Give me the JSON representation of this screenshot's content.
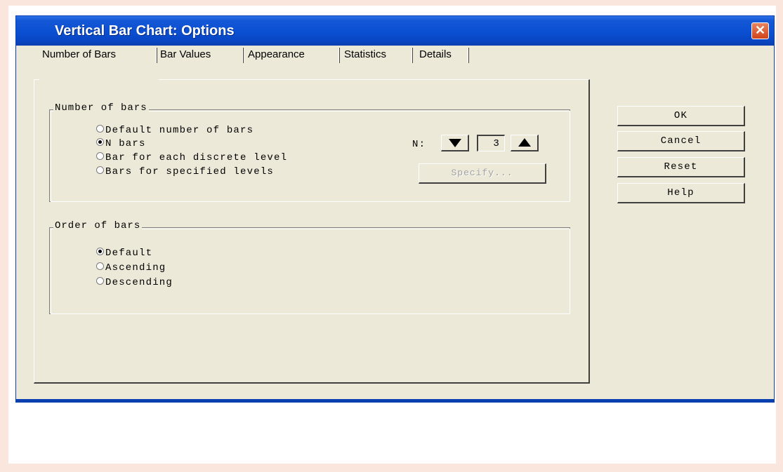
{
  "dialog": {
    "title": "Vertical Bar Chart: Options",
    "close_glyph": "✕"
  },
  "tabs": [
    {
      "label": "Number of Bars",
      "active": true
    },
    {
      "label": "Bar Values",
      "active": false
    },
    {
      "label": "Appearance",
      "active": false
    },
    {
      "label": "Statistics",
      "active": false
    },
    {
      "label": "Details",
      "active": false
    }
  ],
  "number_of_bars": {
    "group_title": "Number of bars",
    "options": [
      {
        "label": "Default number of bars",
        "checked": false
      },
      {
        "label": "N bars",
        "checked": true
      },
      {
        "label": "Bar for each discrete level",
        "checked": false
      },
      {
        "label": "Bars for specified levels",
        "checked": false
      }
    ],
    "n_label": "N:",
    "n_value": "3",
    "specify_label": "Specify..."
  },
  "order_of_bars": {
    "group_title": "Order of bars",
    "options": [
      {
        "label": "Default",
        "checked": true
      },
      {
        "label": "Ascending",
        "checked": false
      },
      {
        "label": "Descending",
        "checked": false
      }
    ]
  },
  "buttons": {
    "ok": "OK",
    "cancel": "Cancel",
    "reset": "Reset",
    "help": "Help"
  },
  "colors": {
    "titlebar": "#0a4fd1",
    "dialog_face": "#ece9d8",
    "page_border": "#fbe6dd"
  }
}
